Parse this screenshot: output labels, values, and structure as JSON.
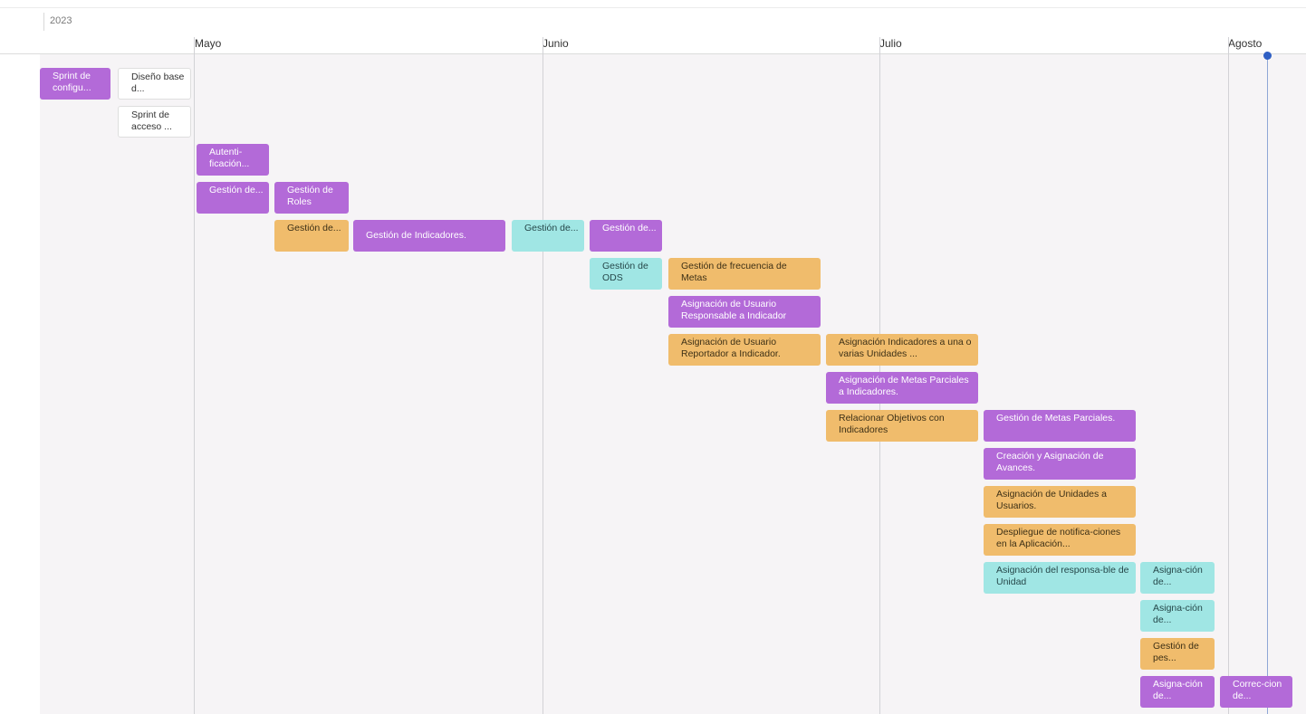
{
  "timeline": {
    "year": "2023",
    "months": [
      "Mayo",
      "Junio",
      "Julio",
      "Agosto"
    ]
  },
  "colors": {
    "feature": "#b36ad8",
    "task": "#f0bc6c",
    "story": "#a0e6e4",
    "sprint": "#ffffff",
    "canvas": "#f6f4f6",
    "today": "#2f5fc4"
  },
  "cards": [
    {
      "label": "Sprint de configu...",
      "type": "purple"
    },
    {
      "label": "Diseño base d...",
      "type": "white"
    },
    {
      "label": "Sprint de acceso ...",
      "type": "white"
    },
    {
      "label": "Autenti-ficación...",
      "type": "purple"
    },
    {
      "label": "Gestión de...",
      "type": "purple"
    },
    {
      "label": "Gestión de Roles",
      "type": "purple"
    },
    {
      "label": "Gestión de...",
      "type": "orange"
    },
    {
      "label": "Gestión de Indicadores.",
      "type": "purple"
    },
    {
      "label": "Gestión de...",
      "type": "teal"
    },
    {
      "label": "Gestión de...",
      "type": "purple"
    },
    {
      "label": "Gestión de ODS",
      "type": "teal"
    },
    {
      "label": "Gestión de frecuencia de Metas",
      "type": "orange"
    },
    {
      "label": "Asignación de Usuario Responsable a Indicador",
      "type": "purple"
    },
    {
      "label": "Asignación de Usuario Reportador a Indicador.",
      "type": "orange"
    },
    {
      "label": "Asignación Indicadores a una o varias Unidades ...",
      "type": "orange"
    },
    {
      "label": "Asignación de Metas Parciales a Indicadores.",
      "type": "purple"
    },
    {
      "label": "Relacionar Objetivos con Indicadores",
      "type": "orange"
    },
    {
      "label": "Gestión de Metas Parciales.",
      "type": "purple"
    },
    {
      "label": "Creación y Asignación de Avances.",
      "type": "purple"
    },
    {
      "label": "Asignación de Unidades a Usuarios.",
      "type": "orange"
    },
    {
      "label": "Despliegue de notifica-ciones en la Aplicación...",
      "type": "orange"
    },
    {
      "label": "Asignación del responsa-ble de Unidad",
      "type": "teal"
    },
    {
      "label": "Asigna-ción de...",
      "type": "teal"
    },
    {
      "label": "Asigna-ción de...",
      "type": "teal"
    },
    {
      "label": "Gestión de pes...",
      "type": "orange"
    },
    {
      "label": "Asigna-ción de...",
      "type": "purple"
    },
    {
      "label": "Correc-cion de...",
      "type": "purple"
    }
  ]
}
